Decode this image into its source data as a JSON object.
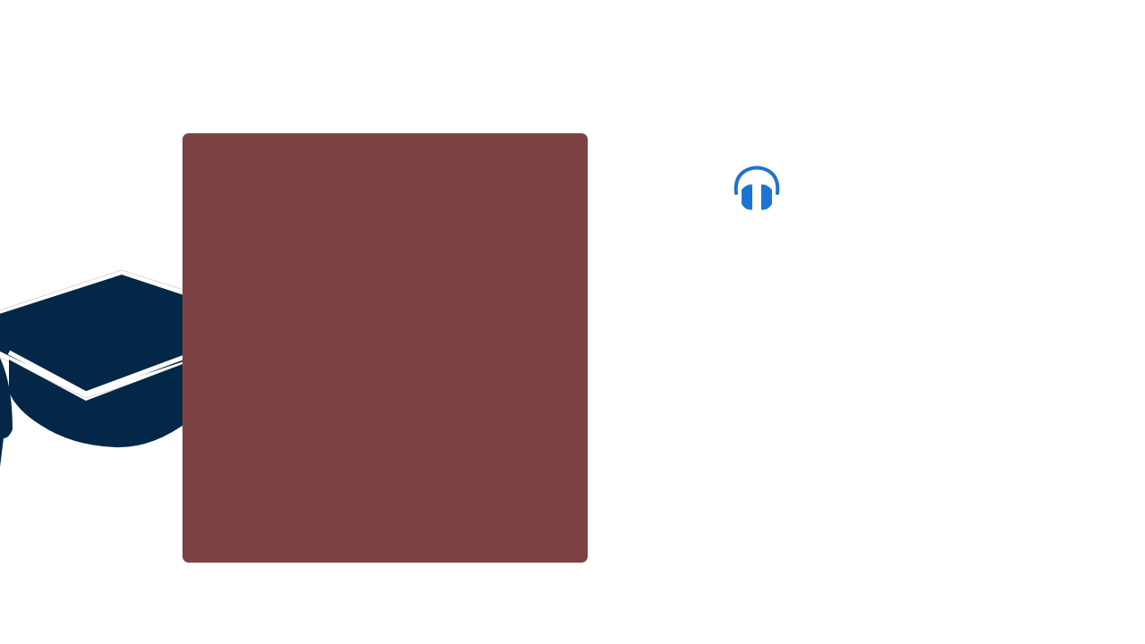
{
  "scene": {
    "background": "#ffffff",
    "illustration": {
      "icon": "graduation-cap-icon",
      "color": "#052747",
      "outline": "#ffffff"
    },
    "card": {
      "color": "#7d4343"
    },
    "audio": {
      "icon": "headphones-icon",
      "color": "#1e73d2"
    }
  }
}
